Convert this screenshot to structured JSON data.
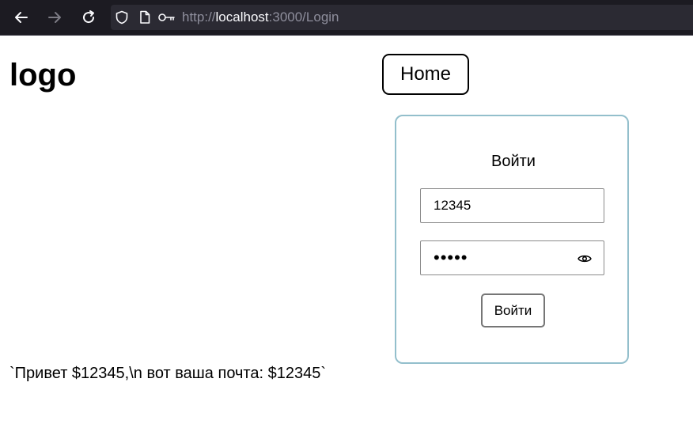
{
  "browser": {
    "url_prefix": "http://",
    "url_host": "localhost",
    "url_rest": ":3000/Login",
    "back_icon": "back-arrow-icon",
    "forward_icon": "forward-arrow-icon",
    "reload_icon": "reload-icon",
    "shield_icon": "shield-icon",
    "page_icon": "page-icon",
    "key_icon": "key-icon"
  },
  "header": {
    "logo": "logo",
    "home_label": "Home"
  },
  "login": {
    "title": "Войти",
    "username_value": "12345",
    "password_value": "12345",
    "eye_icon": "eye-icon",
    "submit_label": "Войти",
    "border_color": "#93bfcc"
  },
  "greeting": "`Привет $12345,\\n вот ваша почта: $12345`"
}
